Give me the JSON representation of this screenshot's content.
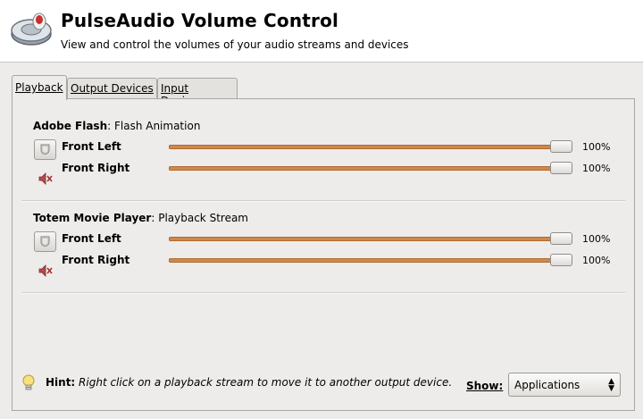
{
  "header": {
    "title": "PulseAudio Volume Control",
    "subtitle": "View and control the volumes of your audio streams and devices",
    "icon": "speaker-app-icon"
  },
  "tabs": [
    {
      "label": "Playback",
      "active": true
    },
    {
      "label": "Output Devices",
      "active": false
    },
    {
      "label": "Input Devices",
      "active": false
    }
  ],
  "streams": [
    {
      "app": "Adobe Flash",
      "desc": ": Flash Animation",
      "channels": [
        {
          "label": "Front Left",
          "value": 100,
          "pct": "100%"
        },
        {
          "label": "Front Right",
          "value": 100,
          "pct": "100%"
        }
      ]
    },
    {
      "app": "Totem Movie Player",
      "desc": ": Playback Stream",
      "channels": [
        {
          "label": "Front Left",
          "value": 100,
          "pct": "100%"
        },
        {
          "label": "Front Right",
          "value": 100,
          "pct": "100%"
        }
      ]
    }
  ],
  "hint": {
    "label": "Hint:",
    "text": " Right click on a playback stream to move it to another output device."
  },
  "show": {
    "label": "Show:",
    "selected": "Applications"
  },
  "colors": {
    "slider_fill": "#cc8a4e",
    "background": "#edeceb"
  }
}
